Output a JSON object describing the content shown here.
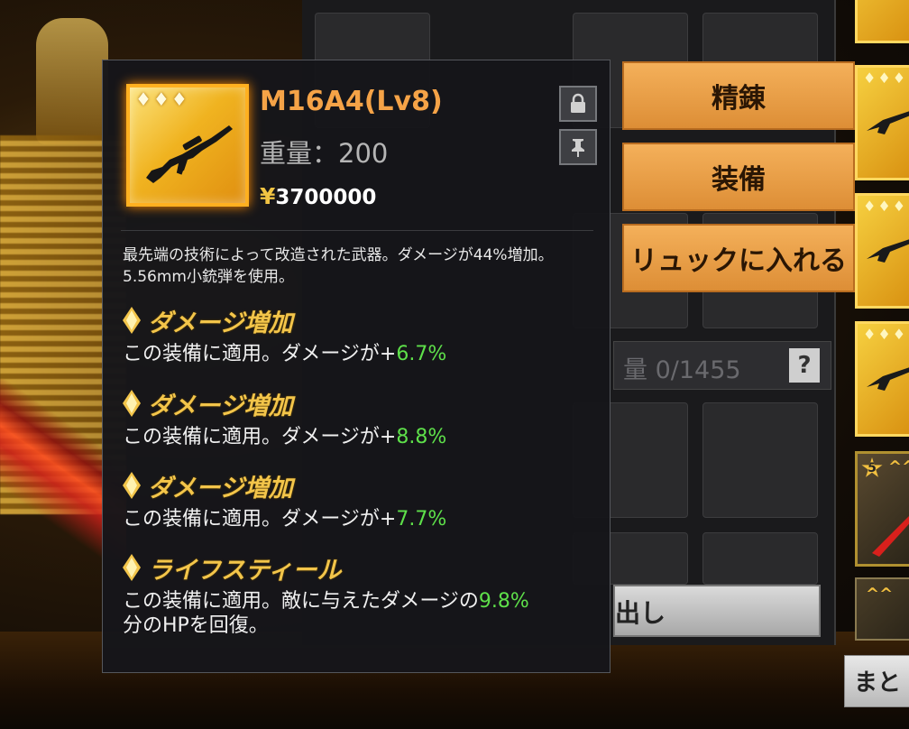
{
  "item": {
    "name": "M16A4(Lv8)",
    "weight": "重量：200",
    "price_symbol": "¥",
    "price": "3700000",
    "icon": "rifle-icon",
    "rarity_diamonds": "♦♦♦",
    "description": "最先端の技術によって改造された武器。ダメージが44%増加。5.56mm小銃弾を使用。"
  },
  "effects": [
    {
      "name": "ダメージ増加",
      "desc_prefix": "この装備に適用。ダメージが+",
      "value": "6.7%",
      "desc_suffix": ""
    },
    {
      "name": "ダメージ増加",
      "desc_prefix": "この装備に適用。ダメージが+",
      "value": "8.8%",
      "desc_suffix": ""
    },
    {
      "name": "ダメージ増加",
      "desc_prefix": "この装備に適用。ダメージが+",
      "value": "7.7%",
      "desc_suffix": ""
    },
    {
      "name": "ライフスティール",
      "desc_prefix": "この装備に適用。敵に与えたダメージの",
      "value": "9.8%",
      "desc_suffix": "分のHPを回復。"
    }
  ],
  "actions": {
    "refine": "精錬",
    "equip": "装備",
    "to_backpack": "リュックに入れる"
  },
  "inventory": {
    "capacity_text": "量 0/1455",
    "help": "?",
    "bottom_button": "出し",
    "summary_button": "まと"
  },
  "thumbs": {
    "diamonds": "♦♦♦",
    "star_level": "5",
    "chevron": "^^"
  },
  "colors": {
    "item_name": "#f5a347",
    "effect_title": "#f3c54a",
    "effect_value": "#5ee04a",
    "action_button": "#eda049"
  }
}
